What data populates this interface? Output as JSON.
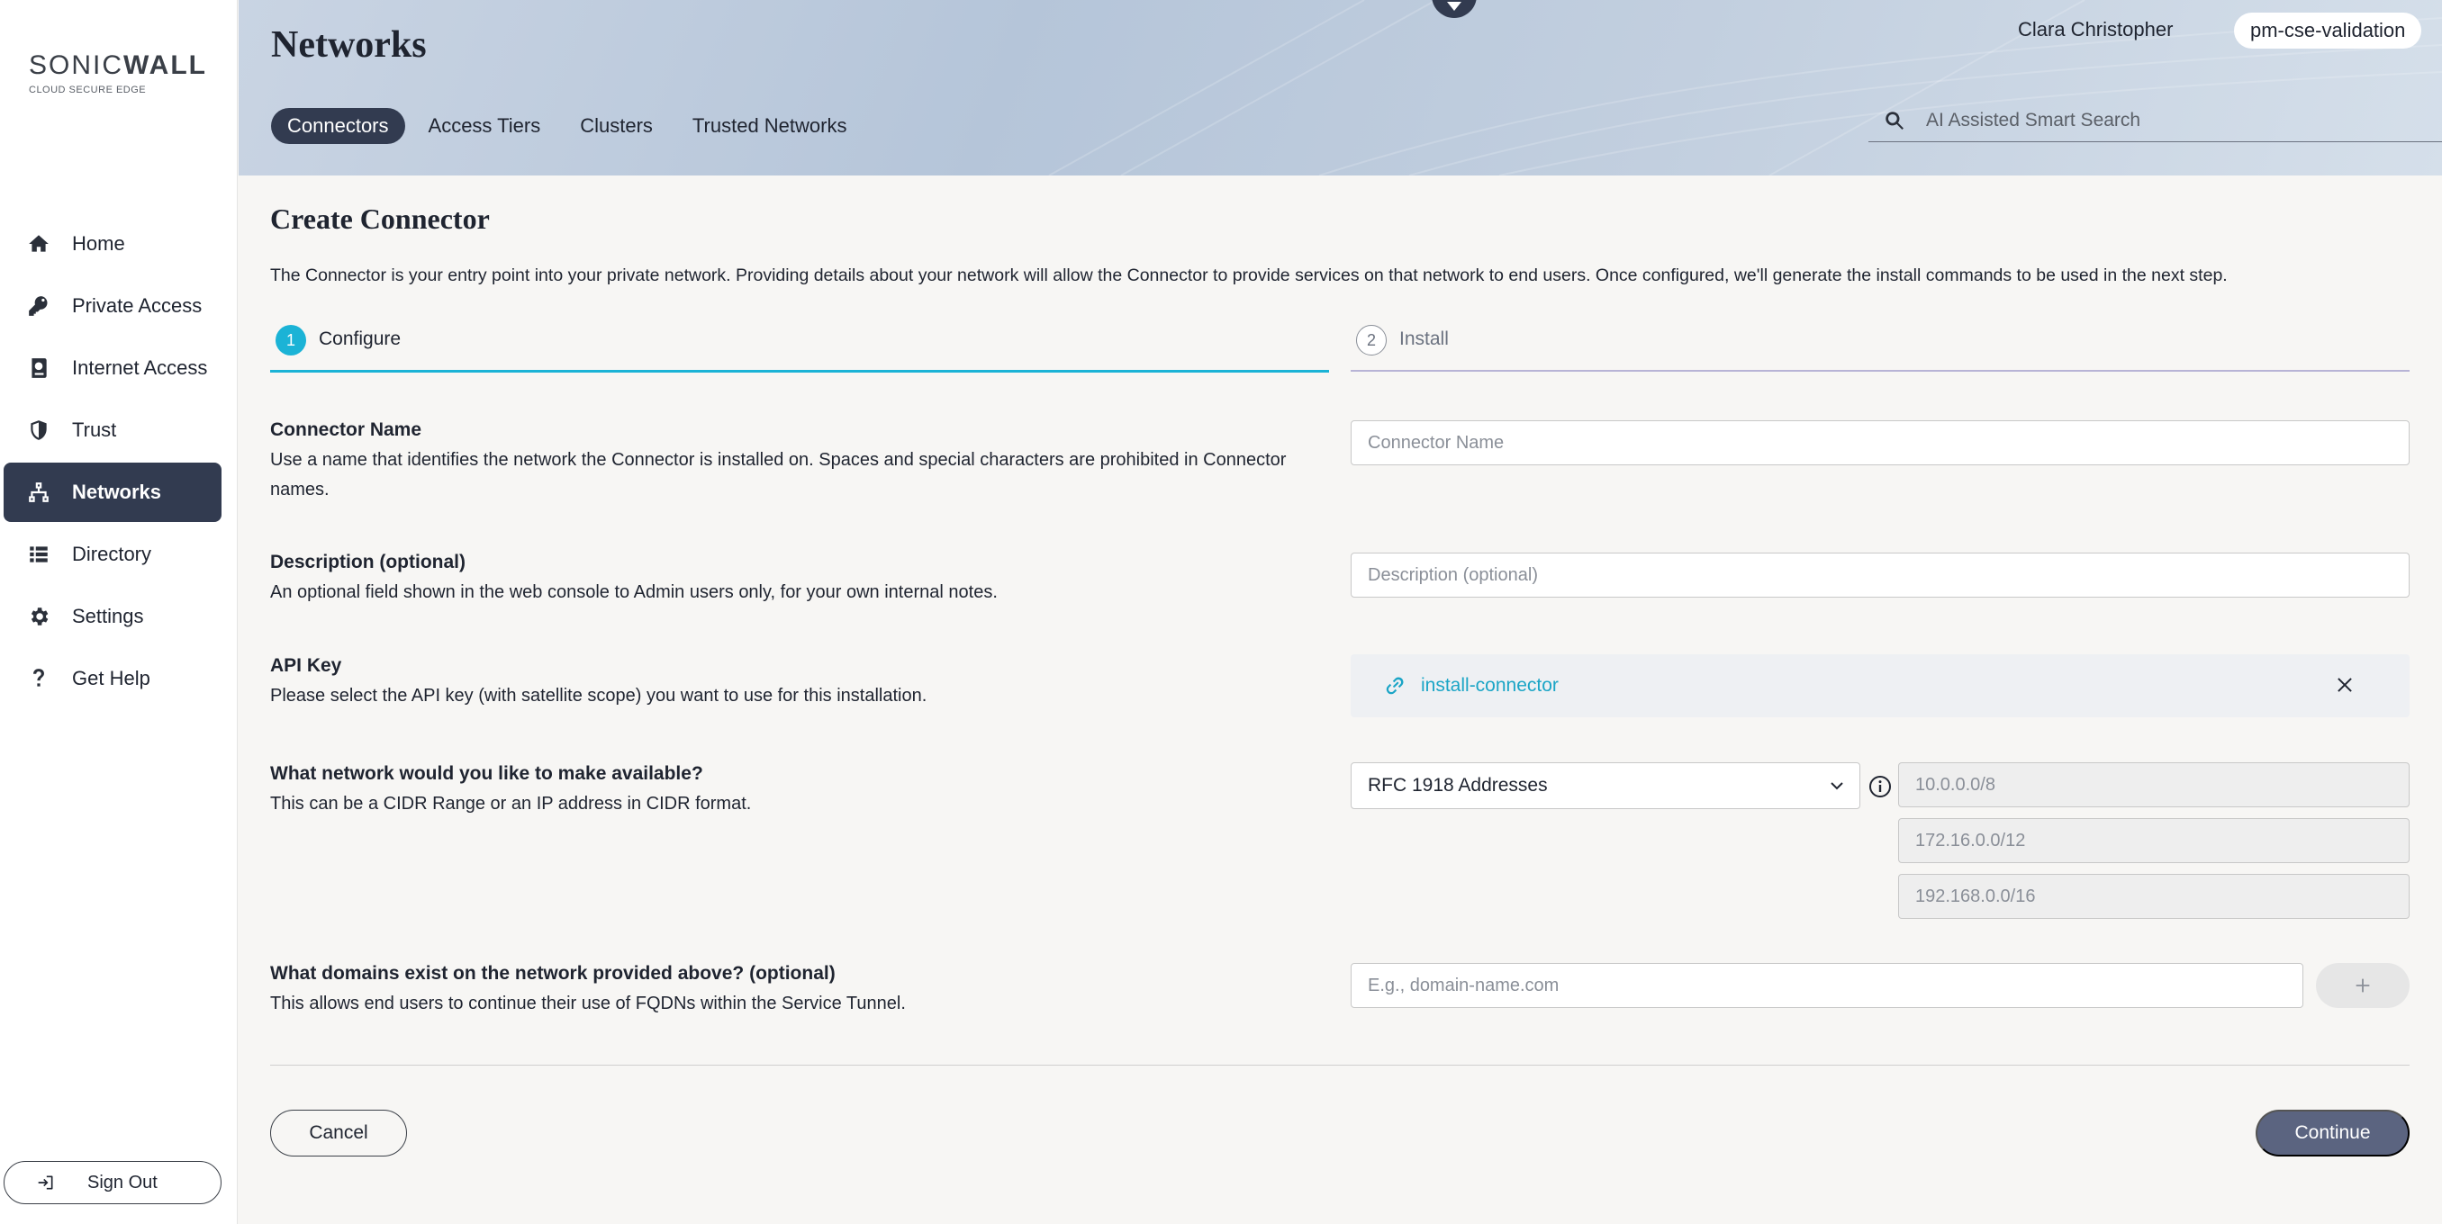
{
  "brand": {
    "logo_text_light": "SONIC",
    "logo_text_bold": "WALL",
    "logo_sub": "CLOUD SECURE EDGE"
  },
  "sidebar": {
    "items": [
      {
        "label": "Home",
        "icon": "home-icon"
      },
      {
        "label": "Private Access",
        "icon": "key-icon"
      },
      {
        "label": "Internet Access",
        "icon": "globe-book-icon"
      },
      {
        "label": "Trust",
        "icon": "shield-icon"
      },
      {
        "label": "Networks",
        "icon": "network-icon",
        "active": true
      },
      {
        "label": "Directory",
        "icon": "list-icon"
      },
      {
        "label": "Settings",
        "icon": "gear-icon"
      },
      {
        "label": "Get Help",
        "icon": "question-icon"
      }
    ],
    "signout_label": "Sign Out"
  },
  "header": {
    "title": "Networks",
    "tabs": [
      "Connectors",
      "Access Tiers",
      "Clusters",
      "Trusted Networks"
    ],
    "active_tab": "Connectors",
    "user_name": "Clara Christopher",
    "org_name": "pm-cse-validation",
    "search_placeholder": "AI Assisted Smart Search"
  },
  "form": {
    "title": "Create Connector",
    "intro": "The Connector is your entry point into your private network. Providing details about your network will allow the Connector to provide services on that network to end users. Once configured, we'll generate the install commands to be used in the next step.",
    "steps": [
      {
        "number": "1",
        "label": "Configure"
      },
      {
        "number": "2",
        "label": "Install"
      }
    ],
    "connector_name": {
      "label": "Connector Name",
      "description": "Use a name that identifies the network the Connector is installed on. Spaces and special characters are prohibited in Connector names.",
      "placeholder": "Connector Name"
    },
    "description": {
      "label": "Description (optional)",
      "description": "An optional field shown in the web console to Admin users only, for your own internal notes.",
      "placeholder": "Description (optional)"
    },
    "api_key": {
      "label": "API Key",
      "description": "Please select the API key (with satellite scope) you want to use for this installation.",
      "selected": "install-connector"
    },
    "network": {
      "label": "What network would you like to make available?",
      "description": "This can be a CIDR Range or an IP address in CIDR format.",
      "selected_option": "RFC 1918 Addresses",
      "ranges": [
        "10.0.0.0/8",
        "172.16.0.0/12",
        "192.168.0.0/16"
      ]
    },
    "domains": {
      "label": "What domains exist on the network provided above? (optional)",
      "description": "This allows end users to continue their use of FQDNs within the Service Tunnel.",
      "placeholder": "E.g., domain-name.com"
    },
    "cancel_label": "Cancel",
    "continue_label": "Continue"
  },
  "colors": {
    "accent": "#1bb3d6",
    "nav_active": "#323b50",
    "link": "#1ba5c6",
    "continue": "#5b6480"
  }
}
